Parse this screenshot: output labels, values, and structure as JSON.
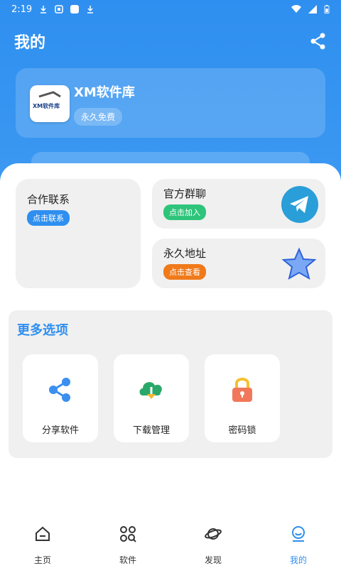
{
  "status_bar": {
    "time": "2:19"
  },
  "header": {
    "title": "我的"
  },
  "profile": {
    "logo_text": "XM软件库",
    "app_name": "XM软件库",
    "badge": "永久免费"
  },
  "cards": {
    "contact": {
      "title": "合作联系",
      "pill": "点击联系",
      "pill_color": "#2f8ff0"
    },
    "group": {
      "title": "官方群聊",
      "pill": "点击加入",
      "pill_color": "#2ec47a"
    },
    "address": {
      "title": "永久地址",
      "pill": "点击查看",
      "pill_color": "#f07a1a"
    }
  },
  "more_options": {
    "title": "更多选项",
    "items": [
      {
        "label": "分享软件",
        "icon": "share-icon"
      },
      {
        "label": "下载管理",
        "icon": "cloud-download-icon"
      },
      {
        "label": "密码锁",
        "icon": "lock-icon"
      }
    ]
  },
  "bottom_nav": {
    "items": [
      {
        "label": "主页",
        "icon": "home-icon"
      },
      {
        "label": "软件",
        "icon": "apps-icon"
      },
      {
        "label": "发现",
        "icon": "planet-icon"
      },
      {
        "label": "我的",
        "icon": "profile-icon",
        "active": true
      }
    ]
  },
  "colors": {
    "primary": "#2f8ff0",
    "card_bg": "#f0f0f0"
  }
}
